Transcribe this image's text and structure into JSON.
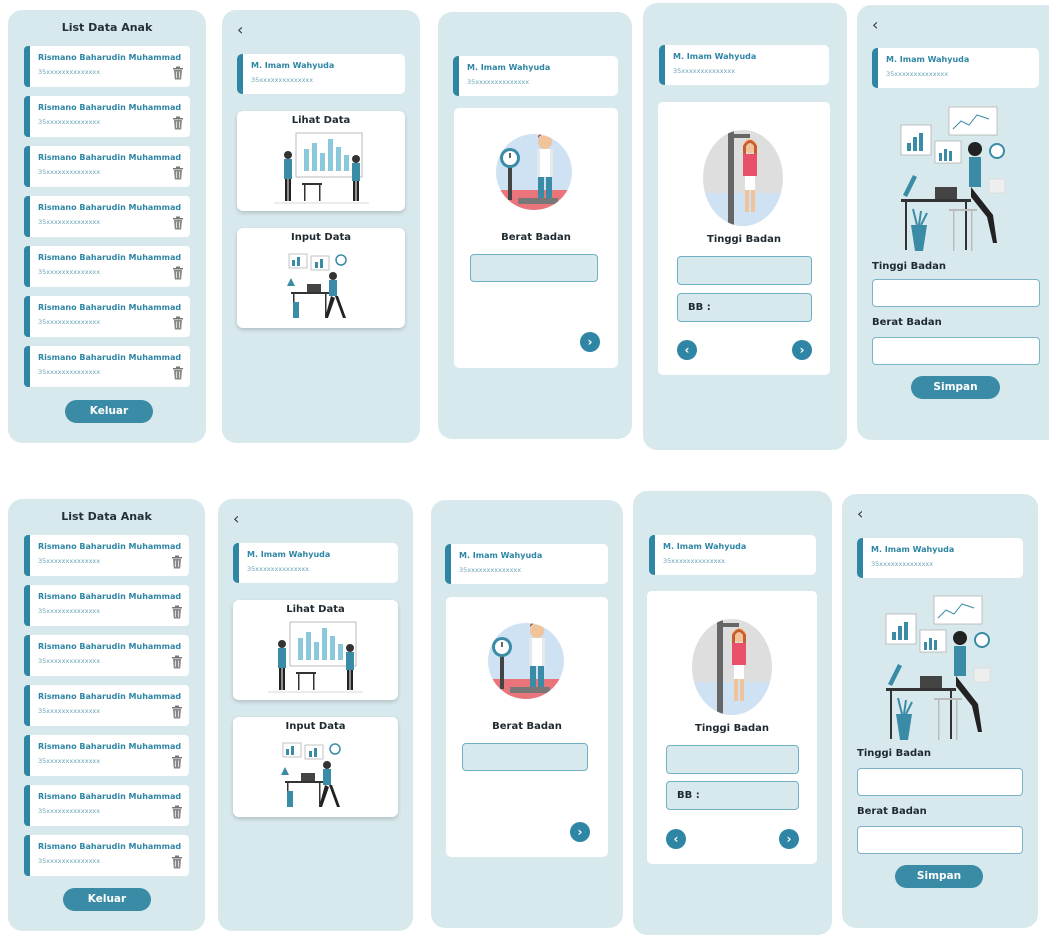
{
  "list_screen": {
    "title": "List Data Anak",
    "items": [
      {
        "name": "Rismano Baharudin Muhammad",
        "id": "35xxxxxxxxxxxxxx"
      },
      {
        "name": "Rismano Baharudin Muhammad",
        "id": "35xxxxxxxxxxxxxx"
      },
      {
        "name": "Rismano Baharudin Muhammad",
        "id": "35xxxxxxxxxxxxxx"
      },
      {
        "name": "Rismano Baharudin Muhammad",
        "id": "35xxxxxxxxxxxxxx"
      },
      {
        "name": "Rismano Baharudin Muhammad",
        "id": "35xxxxxxxxxxxxxx"
      },
      {
        "name": "Rismano Baharudin Muhammad",
        "id": "35xxxxxxxxxxxxxx"
      },
      {
        "name": "Rismano Baharudin Muhammad",
        "id": "35xxxxxxxxxxxxxx"
      }
    ],
    "logout_label": "Keluar"
  },
  "user": {
    "name": "M. Imam Wahyuda",
    "id": "35xxxxxxxxxxxxxx"
  },
  "menu_screen": {
    "back": "‹",
    "view_data": "Lihat Data",
    "input_data": "Input Data"
  },
  "weight_screen": {
    "label": "Berat Badan",
    "next": "›"
  },
  "height_screen": {
    "label": "Tinggi Badan",
    "bb_label": "BB :",
    "prev": "‹",
    "next": "›"
  },
  "form_screen": {
    "back": "‹",
    "height_label": "Tinggi Badan",
    "weight_label": "Berat Badan",
    "save_label": "Simpan"
  },
  "icons": {
    "back": "chevron-left-icon",
    "trash": "trash-icon",
    "next": "chevron-right-icon",
    "prev": "chevron-left-icon"
  },
  "colors": {
    "accent": "#2e86a4",
    "phone_bg": "#d8e9ee",
    "button": "#3a8ba6"
  }
}
